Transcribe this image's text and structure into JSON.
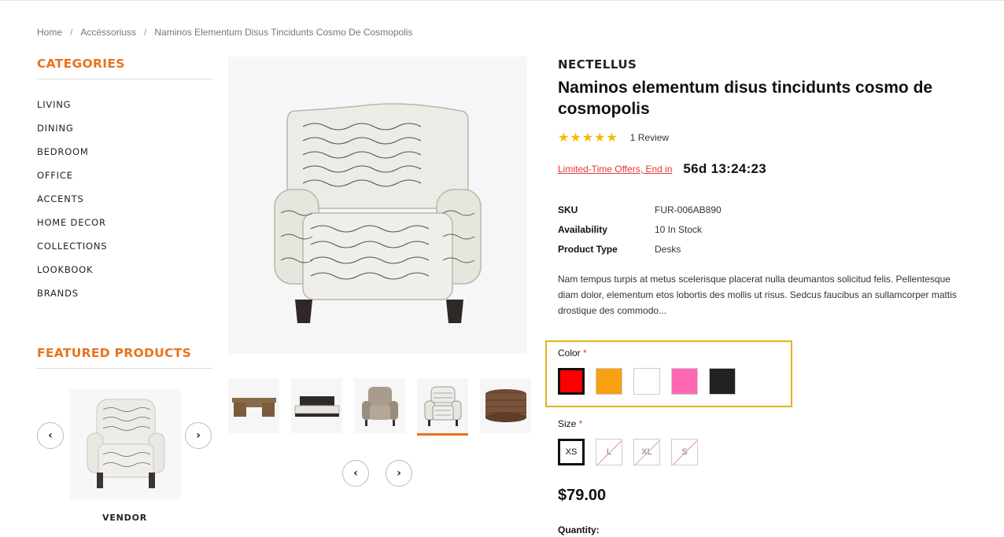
{
  "breadcrumb": [
    "Home",
    "Accéssoriuss",
    "Naminos Elementum Disus Tincidunts Cosmo De Cosmopolis"
  ],
  "sidebar": {
    "categories_title": "CATEGORIES",
    "categories": [
      "LIVING",
      "DINING",
      "BEDROOM",
      "OFFICE",
      "ACCENTS",
      "HOME DECOR",
      "COLLECTIONS",
      "LOOKBOOK",
      "BRANDS"
    ],
    "featured_title": "FEATURED PRODUCTS",
    "featured_item_vendor": "VENDOR"
  },
  "product": {
    "vendor": "NECTELLUS",
    "title": "Naminos elementum disus tincidunts cosmo de cosmopolis",
    "rating_stars": 5,
    "reviews": "1 Review",
    "offer_text": "Limited-Time Offers, End in",
    "countdown": "56d 13:24:23",
    "specs": [
      {
        "key": "SKU",
        "value": "FUR-006AB890"
      },
      {
        "key": "Availability",
        "value": "10 In Stock"
      },
      {
        "key": "Product Type",
        "value": "Desks"
      }
    ],
    "description": "Nam tempus turpis at metus scelerisque placerat nulla deumantos solicitud felis. Pellentesque diam dolor, elementum etos lobortis des mollis ut risus. Sedcus faucibus an sullamcorper mattis drostique des commodo...",
    "color_label": "Color",
    "colors": [
      {
        "name": "red",
        "hex": "#ff0000",
        "selected": true
      },
      {
        "name": "orange",
        "hex": "#f8a010",
        "selected": false
      },
      {
        "name": "white",
        "hex": "#ffffff",
        "selected": false
      },
      {
        "name": "pink",
        "hex": "#ff69b4",
        "selected": false
      },
      {
        "name": "black",
        "hex": "#222222",
        "selected": false
      }
    ],
    "size_label": "Size",
    "sizes": [
      {
        "label": "XS",
        "available": true,
        "selected": true
      },
      {
        "label": "L",
        "available": false,
        "selected": false
      },
      {
        "label": "XL",
        "available": false,
        "selected": false
      },
      {
        "label": "S",
        "available": false,
        "selected": false
      }
    ],
    "price": "$79.00",
    "quantity_label": "Quantity:"
  },
  "gallery": {
    "thumbnails": [
      "desk-thumbnail",
      "bed-thumbnail",
      "beige-armchair-thumbnail",
      "script-armchair-thumbnail",
      "wicker-ottoman-thumbnail"
    ],
    "active_thumbnail": 3
  },
  "colors": {
    "accent": "#e8731c",
    "star": "#f5b800",
    "highlight_box": "#e2b31f",
    "offer": "#e53935"
  }
}
